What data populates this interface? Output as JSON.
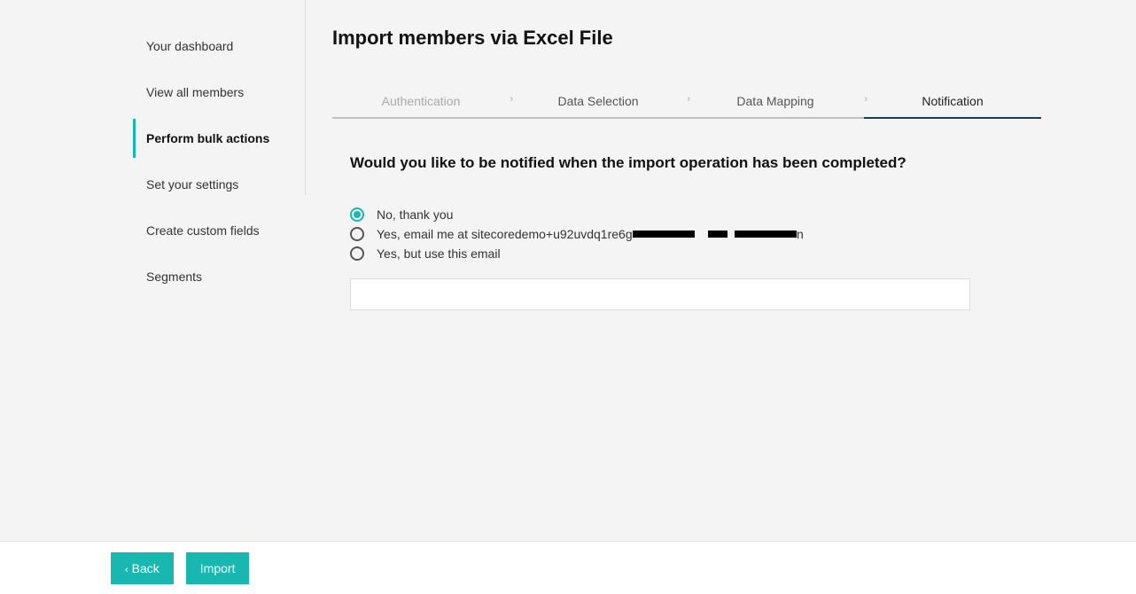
{
  "sidebar": {
    "items": [
      {
        "label": "Your dashboard",
        "active": false
      },
      {
        "label": "View all members",
        "active": false
      },
      {
        "label": "Perform bulk actions",
        "active": true
      },
      {
        "label": "Set your settings",
        "active": false
      },
      {
        "label": "Create custom fields",
        "active": false
      },
      {
        "label": "Segments",
        "active": false
      }
    ]
  },
  "page": {
    "title": "Import members via Excel File"
  },
  "wizard": {
    "steps": [
      {
        "label": "Authentication",
        "state": "disabled"
      },
      {
        "label": "Data Selection",
        "state": "normal"
      },
      {
        "label": "Data Mapping",
        "state": "normal"
      },
      {
        "label": "Notification",
        "state": "active"
      }
    ]
  },
  "notification": {
    "question": "Would you like to be notified when the import operation has been completed?",
    "options": {
      "no": "No, thank you",
      "yes_prefix": "Yes, email me at sitecoredemo+u92uvdq1re6g",
      "yes_alt": "Yes, but use this email"
    },
    "selected": "no",
    "email_value": ""
  },
  "footer": {
    "back_label": "Back",
    "import_label": "Import"
  }
}
